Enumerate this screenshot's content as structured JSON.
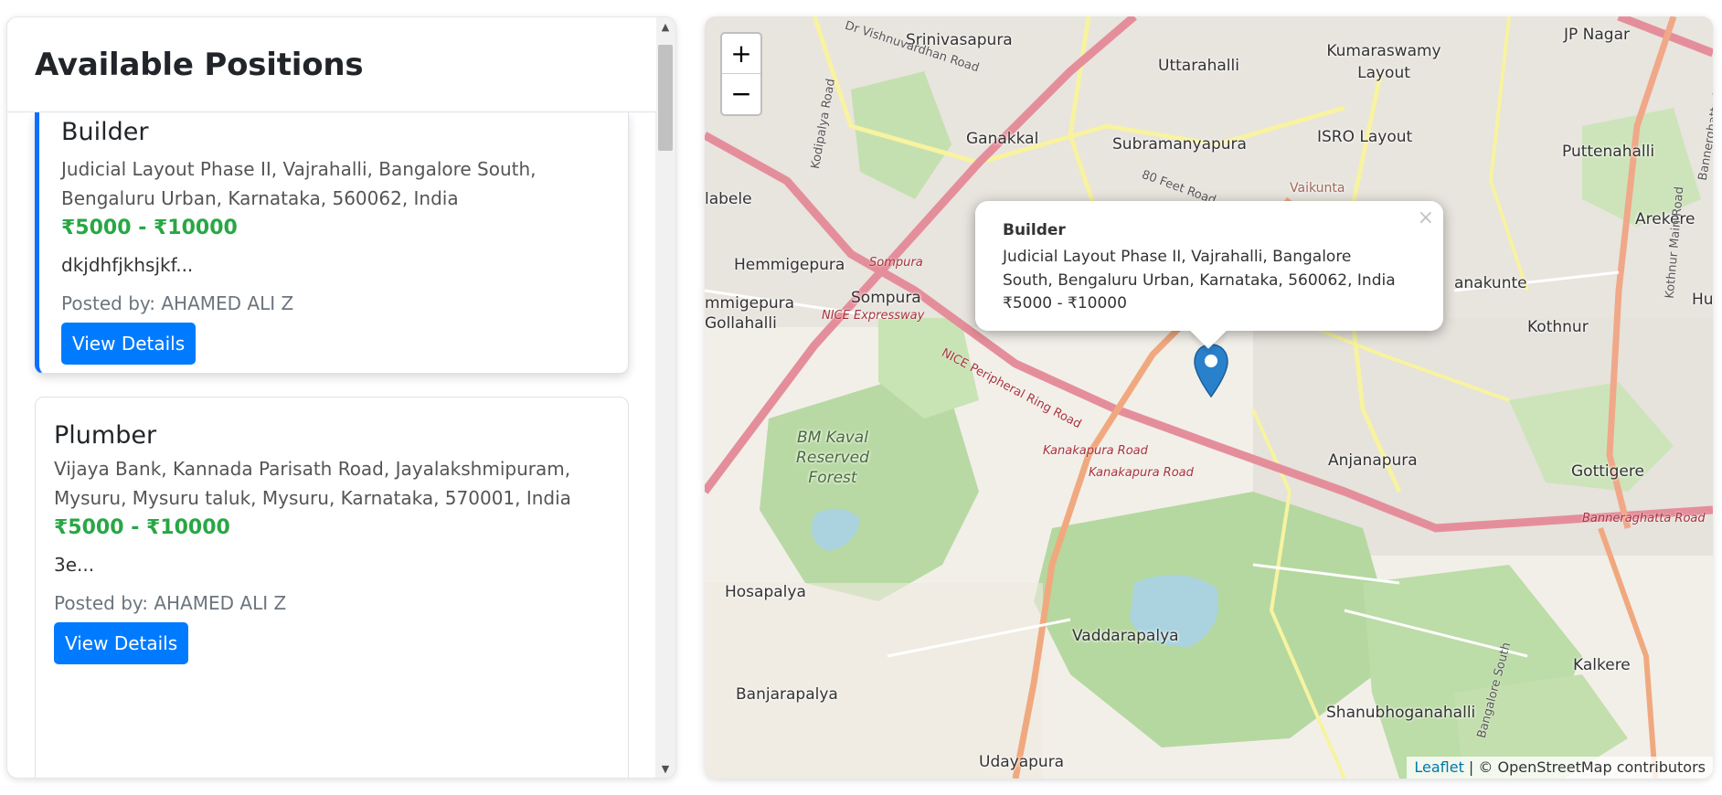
{
  "panel": {
    "title": "Available Positions"
  },
  "listings": [
    {
      "title": "Builder",
      "address": "Judicial Layout Phase II, Vajrahalli, Bangalore South, Bengaluru Urban, Karnataka, 560062, India",
      "salary": "₹5000 - ₹10000",
      "description": "dkjdhfjkhsjkf...",
      "posted_by": "Posted by: AHAMED ALI Z",
      "button": "View Details"
    },
    {
      "title": "Plumber",
      "address": "Vijaya Bank, Kannada Parisath Road, Jayalakshmipuram, Mysuru, Mysuru taluk, Mysuru, Karnataka, 570001, India",
      "salary": "₹5000 - ₹10000",
      "description": "3e...",
      "posted_by": "Posted by: AHAMED ALI Z",
      "button": "View Details"
    }
  ],
  "map": {
    "zoom_in": "+",
    "zoom_out": "−",
    "popup": {
      "close": "×",
      "title": "Builder",
      "address": "Judicial Layout Phase II, Vajrahalli, Bangalore South, Bengaluru Urban, Karnataka, 560062, India",
      "salary": "₹5000 - ₹10000"
    },
    "places": [
      "Srinivasapura",
      "Uttarahalli",
      "Kumaraswamy Layout",
      "JP Nagar",
      "Ganakkal",
      "Subramanyapura",
      "ISRO Layout",
      "Puttenahalli",
      "Vaikunta",
      "Arekere",
      "Hemmigepura",
      "Sompura",
      "mmigepura",
      "Gollahalli",
      "labele",
      "anakunte",
      "Kothnur",
      "Hu",
      "BM Kaval Reserved Forest",
      "Anjanapura",
      "Gottigere",
      "Hosapalya",
      "Vaddarapalya",
      "Kalkere",
      "Banjarapalya",
      "Shanubhoganahalli",
      "Udayapura"
    ],
    "roads": [
      "Dr Vishnuvardhan Road",
      "Kodipalya Road",
      "NICE Peripheral Ring Road",
      "NICE Expressway",
      "Sompura",
      "80 Feet Road",
      "Kanakapura Road",
      "Banneraghatta Road",
      "Kothnur Main Road",
      "Bannerghatta Road",
      "Bangalore South",
      "Kanakapura Road"
    ],
    "attribution_link": "Leaflet",
    "attribution_text": " | © OpenStreetMap contributors"
  }
}
